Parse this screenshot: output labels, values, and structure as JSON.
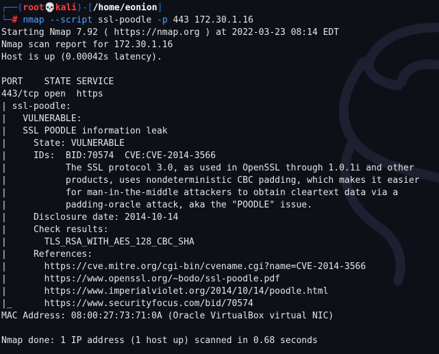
{
  "prompt": {
    "frame_top_left": "┌──(",
    "user": "root",
    "skull_icon": "💀",
    "host": "kali",
    "frame_mid": ")-[",
    "cwd": "/home/eonion",
    "frame_top_right": "]",
    "frame_bottom": "└─",
    "hash": "#",
    "command": "nmap",
    "option1": "--script",
    "arg1": "ssl-poodle",
    "option2": "-p",
    "arg2": "443 172.30.1.16"
  },
  "output": [
    "Starting Nmap 7.92 ( https://nmap.org ) at 2022-03-23 08:14 EDT",
    "Nmap scan report for 172.30.1.16",
    "Host is up (0.00042s latency).",
    "",
    "PORT    STATE SERVICE",
    "443/tcp open  https",
    "| ssl-poodle:",
    "|   VULNERABLE:",
    "|   SSL POODLE information leak",
    "|     State: VULNERABLE",
    "|     IDs:  BID:70574  CVE:CVE-2014-3566",
    "|           The SSL protocol 3.0, as used in OpenSSL through 1.0.1i and other",
    "|           products, uses nondeterministic CBC padding, which makes it easier",
    "|           for man-in-the-middle attackers to obtain cleartext data via a",
    "|           padding-oracle attack, aka the \"POODLE\" issue.",
    "|     Disclosure date: 2014-10-14",
    "|     Check results:",
    "|       TLS_RSA_WITH_AES_128_CBC_SHA",
    "|     References:",
    "|       https://cve.mitre.org/cgi-bin/cvename.cgi?name=CVE-2014-3566",
    "|       https://www.openssl.org/~bodo/ssl-poodle.pdf",
    "|       https://www.imperialviolet.org/2014/10/14/poodle.html",
    "|_      https://www.securityfocus.com/bid/70574",
    "MAC Address: 08:00:27:73:71:0A (Oracle VirtualBox virtual NIC)",
    "",
    "Nmap done: 1 IP address (1 host up) scanned in 0.68 seconds"
  ],
  "watermark_icon": "kali-dragon-icon",
  "colors": {
    "background": "#0e1018",
    "frame": "#2f6fe0",
    "root": "#ff3b3b",
    "command": "#4ea1ff",
    "text": "#e6e6e6"
  }
}
